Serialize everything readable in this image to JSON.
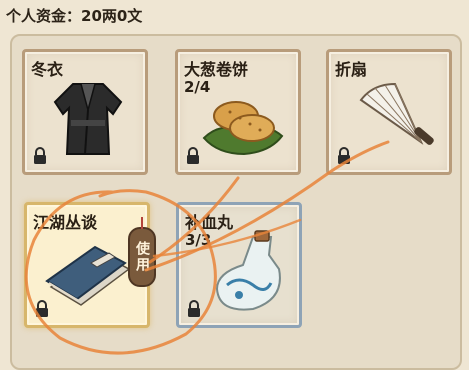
{
  "header": {
    "funds_text": "个人资金：20两0文"
  },
  "inventory": {
    "items": [
      {
        "name": "冬衣",
        "count": "",
        "icon": "winter-coat-icon",
        "locked": true
      },
      {
        "name": "大葱卷饼",
        "count": "2/4",
        "icon": "scallion-pancake-icon",
        "locked": true
      },
      {
        "name": "折扇",
        "count": "",
        "icon": "folding-fan-icon",
        "locked": true
      },
      {
        "name": "江湖丛谈",
        "count": "",
        "icon": "book-icon",
        "locked": true,
        "selected": true
      },
      {
        "name": "补血丸",
        "count": "3/3",
        "icon": "potion-bottle-icon",
        "locked": true
      }
    ],
    "use_button_label": "使用"
  },
  "colors": {
    "background": "#efe6d3",
    "slot_border": "#b89c7b",
    "selected_border": "#d7b66b",
    "annotation": "#e8843a"
  }
}
